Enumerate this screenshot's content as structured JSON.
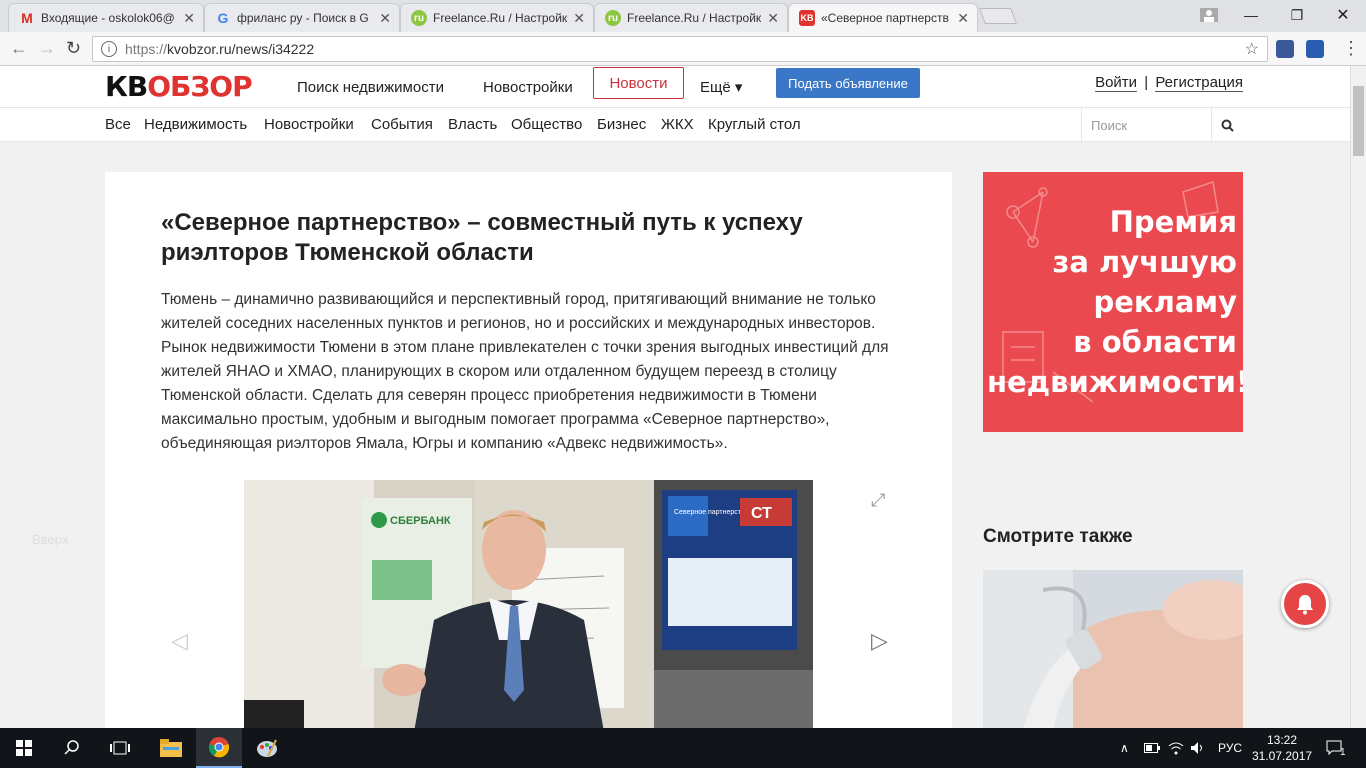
{
  "browser": {
    "tabs": [
      {
        "title": "Входящие - oskolok06@",
        "favicon": "gmail-icon"
      },
      {
        "title": "фриланс ру - Поиск в G",
        "favicon": "google-icon"
      },
      {
        "title": "Freelance.Ru / Настройк",
        "favicon": "freelance-icon"
      },
      {
        "title": "Freelance.Ru / Настройк",
        "favicon": "freelance-icon"
      },
      {
        "title": "«Северное партнерств",
        "favicon": "kv-icon"
      }
    ],
    "url_proto": "https://",
    "url_rest": "kvobzor.ru/news/i34222",
    "accent": "#c9343a"
  },
  "site": {
    "logo_kv": "КВ",
    "logo_obzor": "ОБЗОР",
    "nav": {
      "search": "Поиск недвижимости",
      "new_builds": "Новостройки",
      "news": "Новости",
      "more": "Ещё ▾",
      "post_ad": "Подать объявление",
      "login": "Войти",
      "separator": "|",
      "register": "Регистрация"
    },
    "subnav": [
      "Все",
      "Недвижимость",
      "Новостройки",
      "События",
      "Власть",
      "Общество",
      "Бизнес",
      "ЖКХ",
      "Круглый стол"
    ],
    "search_placeholder": "Поиск"
  },
  "article": {
    "title": "«Северное партнерство» – совместный путь к успеху риэлторов Тюменской области",
    "lead": "Тюмень – динамично развивающийся и перспективный город, притягивающий внимание не только жителей соседних населенных пунктов и регионов, но и российских и международных инвесторов. Рынок недвижимости Тюмени в этом плане привлекателен с точки зрения выгодных инвестиций для жителей ЯНАО и ХМАО, планирующих в скором или отдаленном будущем переезд в столицу Тюменской области. Сделать для северян процесс приобретения недвижимости в Тюмени максимально простым, удобным и выгодным помогает программа «Северное партнерство», объединяющая риэлторов Ямала, Югры и компанию «Адвекс недвижимость».",
    "photo_bank_text": "СБЕРБАНК",
    "photo_screen_text": "Северное партнерство",
    "photo_channel": "СТ"
  },
  "sidebar": {
    "ad_lines": [
      "Премия",
      "за лучшую",
      "рекламу",
      "в области",
      "недвижимости!"
    ],
    "see_also": "Смотрите также",
    "vverh": "Вверх"
  },
  "taskbar": {
    "lang": "РУС",
    "time": "13:22",
    "date": "31.07.2017",
    "notifications": "1"
  }
}
